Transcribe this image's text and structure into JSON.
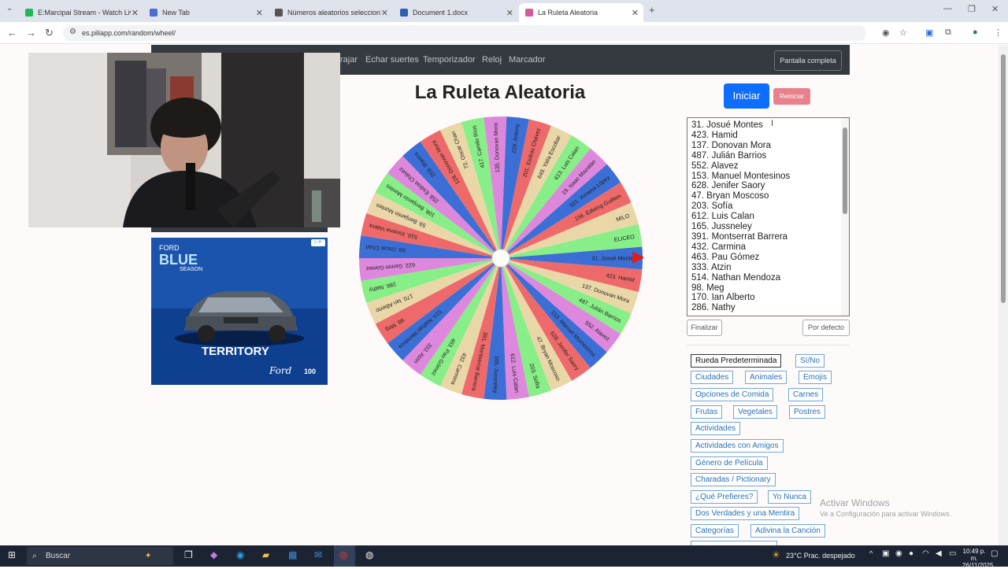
{
  "browser": {
    "tabs": [
      {
        "label": "E:Marcipai Stream - Watch Live",
        "color": "#1db954"
      },
      {
        "label": "New Tab",
        "color": "#4a6cd4"
      },
      {
        "label": "Números aleatorios selecciona",
        "color": "#555555"
      },
      {
        "label": "Document 1.docx",
        "color": "#2b5fb8"
      },
      {
        "label": "La Ruleta Aleatoria",
        "color": "#d45a9a"
      }
    ],
    "url": "es.piliapp.com/random/wheel/"
  },
  "site": {
    "nav": [
      "rajar",
      "Echar suertes",
      "Temporizador",
      "Reloj",
      "Marcador"
    ],
    "fullscreen_label": "Pantalla completa",
    "title": "La Ruleta Aleatoria",
    "start_label": "Iniciar",
    "reset_label": "Reiniciar",
    "names": [
      "31. Josué Montes",
      "423. Hamid",
      "137. Donovan Mora",
      "487. Julián Barrios",
      "552. Alavez",
      "153. Manuel Montesinos",
      "628. Jenifer Saory",
      "47. Bryan Moscoso",
      "203. Sofía",
      "612. Luis Calan",
      "165. Jussneley",
      "391. Montserrat Barrera",
      "432. Carmina",
      "463. Pau Gómez",
      "333. Atzin",
      "514. Nathan Mendoza",
      "98. Meg",
      "170. Ian Alberto",
      "286. Nathy"
    ],
    "finish_label": "Finalizar",
    "default_label": "Por defecto",
    "categories": [
      "Rueda Predeterminada",
      "Sí/No",
      "Ciudades",
      "Animales",
      "Emojis",
      "Opciones de Comida",
      "Carnes",
      "Frutas",
      "Vegetales",
      "Postres",
      "Actividades",
      "Actividades con Amigos",
      "Género de Película",
      "Charadas / Pictionary",
      "¿Qué Prefieres?",
      "Yo Nunca",
      "Dos Verdades y una Mentira",
      "Categorías",
      "Adivina la Canción"
    ],
    "watermark_title": "Activar Windows",
    "watermark_sub": "Ve a Configuración para activar Windows."
  },
  "wheel": {
    "labels": [
      "31. Josué Montes",
      "423. Hamid",
      "137. Donovan Mora",
      "487. Julián Barrios",
      "552. Alavez",
      "153. Manuel Montesinos",
      "628. Jenifer Saory",
      "47. Bryan Moscoso",
      "203. Sofía",
      "612. Luis Calan",
      "165. Jussneley",
      "391. Montserrat Barrera",
      "432. Carmina",
      "463. Pau Gómez",
      "333. Atzin",
      "514. Nathan Mendoza",
      "98. Meg",
      "170. Ian Alberto",
      "286. Nathy",
      "622. Gemm Gómez",
      "69. Oscar Chan",
      "510. Ximena Valera",
      "59. Benjamín Montes",
      "108. Benjamín Montes",
      "258. Esdras Chávez",
      "259. Blanca",
      "128. Donovan Mora",
      "72. Oscar Chan",
      "417. Camilo Ríos",
      "135. Donovan Mora",
      "229. Antony",
      "201. Esdras Chávez",
      "649. Yalia Escobar",
      "613. Luis Calan",
      "19. Isaac Mazatán",
      "501. Ximena López",
      "156. Edwing Guillem",
      "MILO",
      "ELICEO"
    ],
    "colors": [
      "#3b6fd6",
      "#ee6a6a",
      "#ead7a8",
      "#88ee88",
      "#dd88dd"
    ]
  },
  "ad": {
    "brand_small": "FORD",
    "brand_big": "BLUE",
    "brand_sub": "SEASON",
    "model": "TERRITORY",
    "logo": "Ford",
    "badge": "100"
  },
  "taskbar": {
    "search": "Buscar",
    "weather": "23°C  Prac. despejado",
    "time": "10:49 p. m.",
    "date": "26/11/2025"
  }
}
